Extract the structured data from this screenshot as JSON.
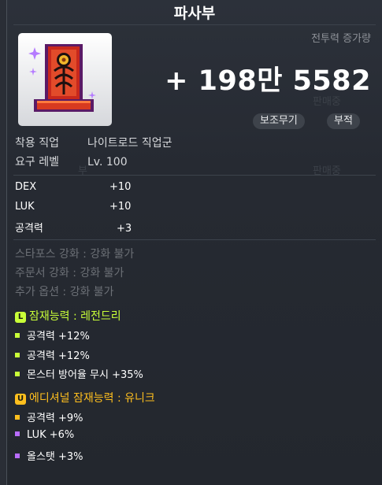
{
  "item": {
    "name": "파사부"
  },
  "combat_power": {
    "label": "전투력 증가량",
    "value": "+ 198만 5582"
  },
  "tags": [
    "보조무기",
    "부적"
  ],
  "faded_labels": [
    "판매중",
    "판매중",
    "부"
  ],
  "requirements": [
    {
      "label": "착용 직업",
      "value": "나이트로드 직업군"
    },
    {
      "label": "요구 레벨",
      "value": "Lv. 100"
    }
  ],
  "stats": [
    {
      "label": "DEX",
      "value": "+10"
    },
    {
      "label": "LUK",
      "value": "+10"
    },
    {
      "label": "공격력",
      "value": "+3"
    }
  ],
  "upgrade_info": [
    "스타포스 강화 : 강화 불가",
    "주문서 강화 : 강화 불가",
    "추가 옵션 : 강화 불가"
  ],
  "potential": {
    "badge": "L",
    "title": "잠재능력 : 레전드리",
    "color": "#c9ff38",
    "lines": [
      "공격력 +12%",
      "공격력 +12%",
      "몬스터 방어율 무시 +35%"
    ]
  },
  "additional_potential": {
    "badge": "U",
    "title": "에디셔널 잠재능력 : 유니크",
    "color": "#ffbf1e",
    "lines": [
      "공격력 +9%",
      "LUK +6%",
      "올스탯 +3%"
    ]
  },
  "icon": "red-talisman-icon"
}
